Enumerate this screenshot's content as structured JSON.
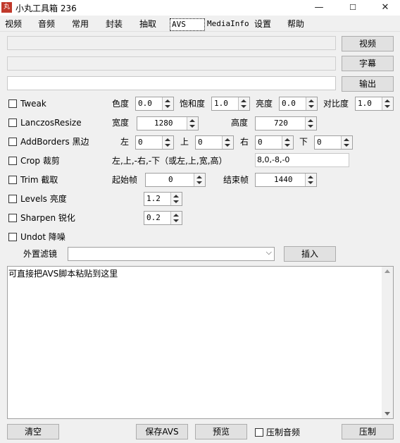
{
  "window": {
    "icon_text": "丸",
    "title": "小丸工具箱 236",
    "controls": {
      "minimize": "—",
      "maximize": "☐",
      "close": "✕"
    }
  },
  "tabs": [
    "视频",
    "音频",
    "常用",
    "封装",
    "抽取",
    "AVS",
    "MediaInfo",
    "设置",
    "帮助"
  ],
  "active_tab": "AVS",
  "file_buttons": {
    "video": "视频",
    "subtitle": "字幕",
    "output": "输出"
  },
  "filters": {
    "tweak": {
      "label": "Tweak",
      "checked": false,
      "hue_label": "色度",
      "hue": "0.0",
      "saturation_label": "饱和度",
      "saturation": "1.0",
      "brightness_label": "亮度",
      "brightness": "0.0",
      "contrast_label": "对比度",
      "contrast": "1.0"
    },
    "lanczos": {
      "label": "LanczosResize",
      "checked": false,
      "width_label": "宽度",
      "width": "1280",
      "height_label": "高度",
      "height": "720"
    },
    "addborders": {
      "label": "AddBorders 黑边",
      "checked": false,
      "left_label": "左",
      "left": "0",
      "top_label": "上",
      "top": "0",
      "right_label": "右",
      "right": "0",
      "bottom_label": "下",
      "bottom": "0"
    },
    "crop": {
      "label": "Crop 裁剪",
      "checked": false,
      "hint": "左,上,-右,-下（或左,上,宽,高）",
      "value": "8,0,-8,-0"
    },
    "trim": {
      "label": "Trim 截取",
      "checked": false,
      "start_label": "起始帧",
      "start": "0",
      "end_label": "结束帧",
      "end": "1440"
    },
    "levels": {
      "label": "Levels 亮度",
      "checked": false,
      "value": "1.2"
    },
    "sharpen": {
      "label": "Sharpen 锐化",
      "checked": false,
      "value": "0.2"
    },
    "undot": {
      "label": "Undot 降噪",
      "checked": false
    }
  },
  "external_filter": {
    "label": "外置滤镜",
    "value": "",
    "insert_button": "插入"
  },
  "script_area": {
    "text": "可直接把AVS脚本粘贴到这里"
  },
  "bottom": {
    "clear_button": "清空",
    "save_button": "保存AVS",
    "preview_button": "预览",
    "suppress_audio_label": "压制音频",
    "suppress_audio_checked": false,
    "encode_button": "压制"
  }
}
